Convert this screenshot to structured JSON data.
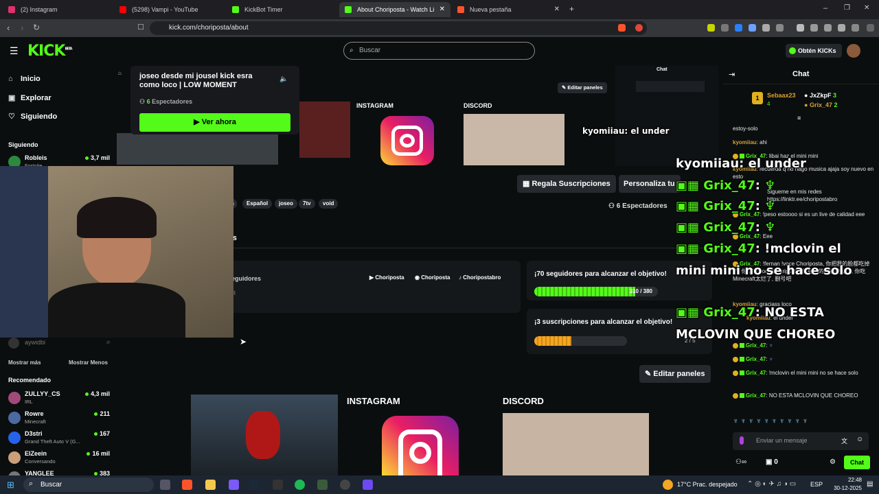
{
  "browser": {
    "tabs": [
      {
        "label": "(2) Instagram",
        "color": "#e1306c"
      },
      {
        "label": "(5298) Vampi - YouTube",
        "color": "#ff0000"
      },
      {
        "label": "KickBot Timer",
        "color": "#53fc18"
      },
      {
        "label": "About Choriposta - Watch Li",
        "color": "#53fc18"
      },
      {
        "label": "Nueva pestaña",
        "color": "#fb542b"
      }
    ],
    "url": "kick.com/choriposta/about"
  },
  "header": {
    "logo": "KICK",
    "logo_sup": "BETA",
    "search_placeholder": "Buscar",
    "get_kicks": "Obtén KICKs"
  },
  "sidebar": {
    "nav": [
      {
        "label": "Inicio"
      },
      {
        "label": "Explorar"
      },
      {
        "label": "Siguiendo"
      }
    ],
    "following_title": "Siguiendo",
    "following": [
      {
        "name": "Robleis",
        "game": "Fortnite",
        "viewers": "3,7 mil"
      }
    ],
    "offline_name": "aywidbi",
    "show_more": "Mostrar más",
    "show_less": "Mostrar Menos",
    "recommended_title": "Recomendado",
    "recommended": [
      {
        "name": "ZULLYY_CS",
        "game": "IRL",
        "viewers": "4,3 mil"
      },
      {
        "name": "Rowre",
        "game": "Minecraft",
        "viewers": "211"
      },
      {
        "name": "D3stri",
        "game": "Grand Theft Auto V (G...",
        "viewers": "167"
      },
      {
        "name": "ElZeein",
        "game": "Conversando",
        "viewers": "16 mil"
      },
      {
        "name": "YANGLEE",
        "game": "",
        "viewers": "383"
      }
    ]
  },
  "popup": {
    "title": "joseo desde mi jousel kick esra como loco | LOW MOMENT",
    "viewers_num": "6",
    "viewers_label": "Espectadores",
    "watch": "Ver ahora"
  },
  "main": {
    "edit_panels_small": "Editar paneles",
    "instagram_small": "INSTAGRAM",
    "discord_small": "DISCORD",
    "big_overlay_chat": [
      {
        "user": "kyomiiau",
        "text": "el under"
      }
    ],
    "gift_subs": "Regala Suscripciones",
    "personalize": "Personaliza tu",
    "tags": [
      "n",
      "Español",
      "joseo",
      "7tv",
      "void"
    ],
    "viewers": "6 Espectadores",
    "tab_fragment": "os",
    "followers_fragment": "seguidores",
    "er_fragment": "ER",
    "socials": [
      "Choriposta",
      "Choriposta",
      "Choripostabro"
    ],
    "goal1": {
      "title": "¡70 seguidores para alcanzar el objetivo!",
      "progress": "310 / 380",
      "fraction": 0.815
    },
    "goal2": {
      "title": "¡3 suscripciones para alcanzar el objetivo!",
      "progress": "2 / 5",
      "fraction": 0.4
    },
    "edit_panels": "Editar paneles",
    "instagram": "INSTAGRAM",
    "discord": "DISCORD"
  },
  "chat": {
    "title": "Chat",
    "top": [
      {
        "name": "Sebaax23",
        "count": "4"
      },
      {
        "name": "JxZkpF",
        "count": "3"
      },
      {
        "name": "Grix_47",
        "count": "2"
      }
    ],
    "messages": [
      {
        "user": "",
        "text": "estoy-solo"
      },
      {
        "user": "kyomiiau",
        "text": "ahi"
      },
      {
        "user": "Grix_47",
        "text": "libai haz el mini mini"
      },
      {
        "user": "kyomiiau",
        "text": "recuerda q no hago musica ajaja soy nuevo en esto"
      },
      {
        "user": "",
        "text": "Sigueme en mis redes https://linktr.ee/choripostabro"
      },
      {
        "user": "Grix_47",
        "text": "!peso estoooo si es un live de calidad eee"
      },
      {
        "user": "Grix_47",
        "text": "Eee"
      },
      {
        "user": "Grix_47",
        "text": "!fernan !voce Choriposta, 你把我的脸都吃掉了, 你吃吧!voce Choriposta, 你把我的脸都吃掉了, 你吃 Minecraft太烂了, 删号吧"
      },
      {
        "user": "kyomiiau",
        "text": "graciass loco"
      },
      {
        "user": "kyomiiau",
        "text": "el under"
      },
      {
        "user": "Grix_47",
        "text": ""
      },
      {
        "user": "Grix_47",
        "text": ""
      },
      {
        "user": "Grix_47",
        "text": "!mclovin el mini mini no se hace solo"
      },
      {
        "user": "Grix_47",
        "text": "NO ESTA MCLOVIN QUE CHOREO"
      }
    ],
    "input_placeholder": "Enviar un mensaje",
    "points": "0",
    "send": "Chat"
  },
  "overlay": {
    "lines": [
      {
        "user": "kyomiiau",
        "text": "el under"
      },
      {
        "user": "Grix_47",
        "text": ""
      },
      {
        "user": "Grix_47",
        "text": ""
      },
      {
        "user": "Grix_47",
        "text": ""
      },
      {
        "user": "Grix_47",
        "text": "!mclovin el"
      },
      {
        "user": "",
        "text": "mini mini no se hace solo"
      },
      {
        "user": "Grix_47",
        "text": "NO ESTA"
      },
      {
        "user": "",
        "text": "MCLOVIN QUE CHOREO"
      }
    ]
  },
  "taskbar": {
    "search": "Buscar",
    "weather": "17°C  Prac. despejado",
    "lang": "ESP",
    "time": "22:48",
    "date": "30-12-2025"
  },
  "colors": {
    "kick_green": "#53fc18",
    "bg": "#0b0e0f",
    "panel": "#26292e"
  }
}
